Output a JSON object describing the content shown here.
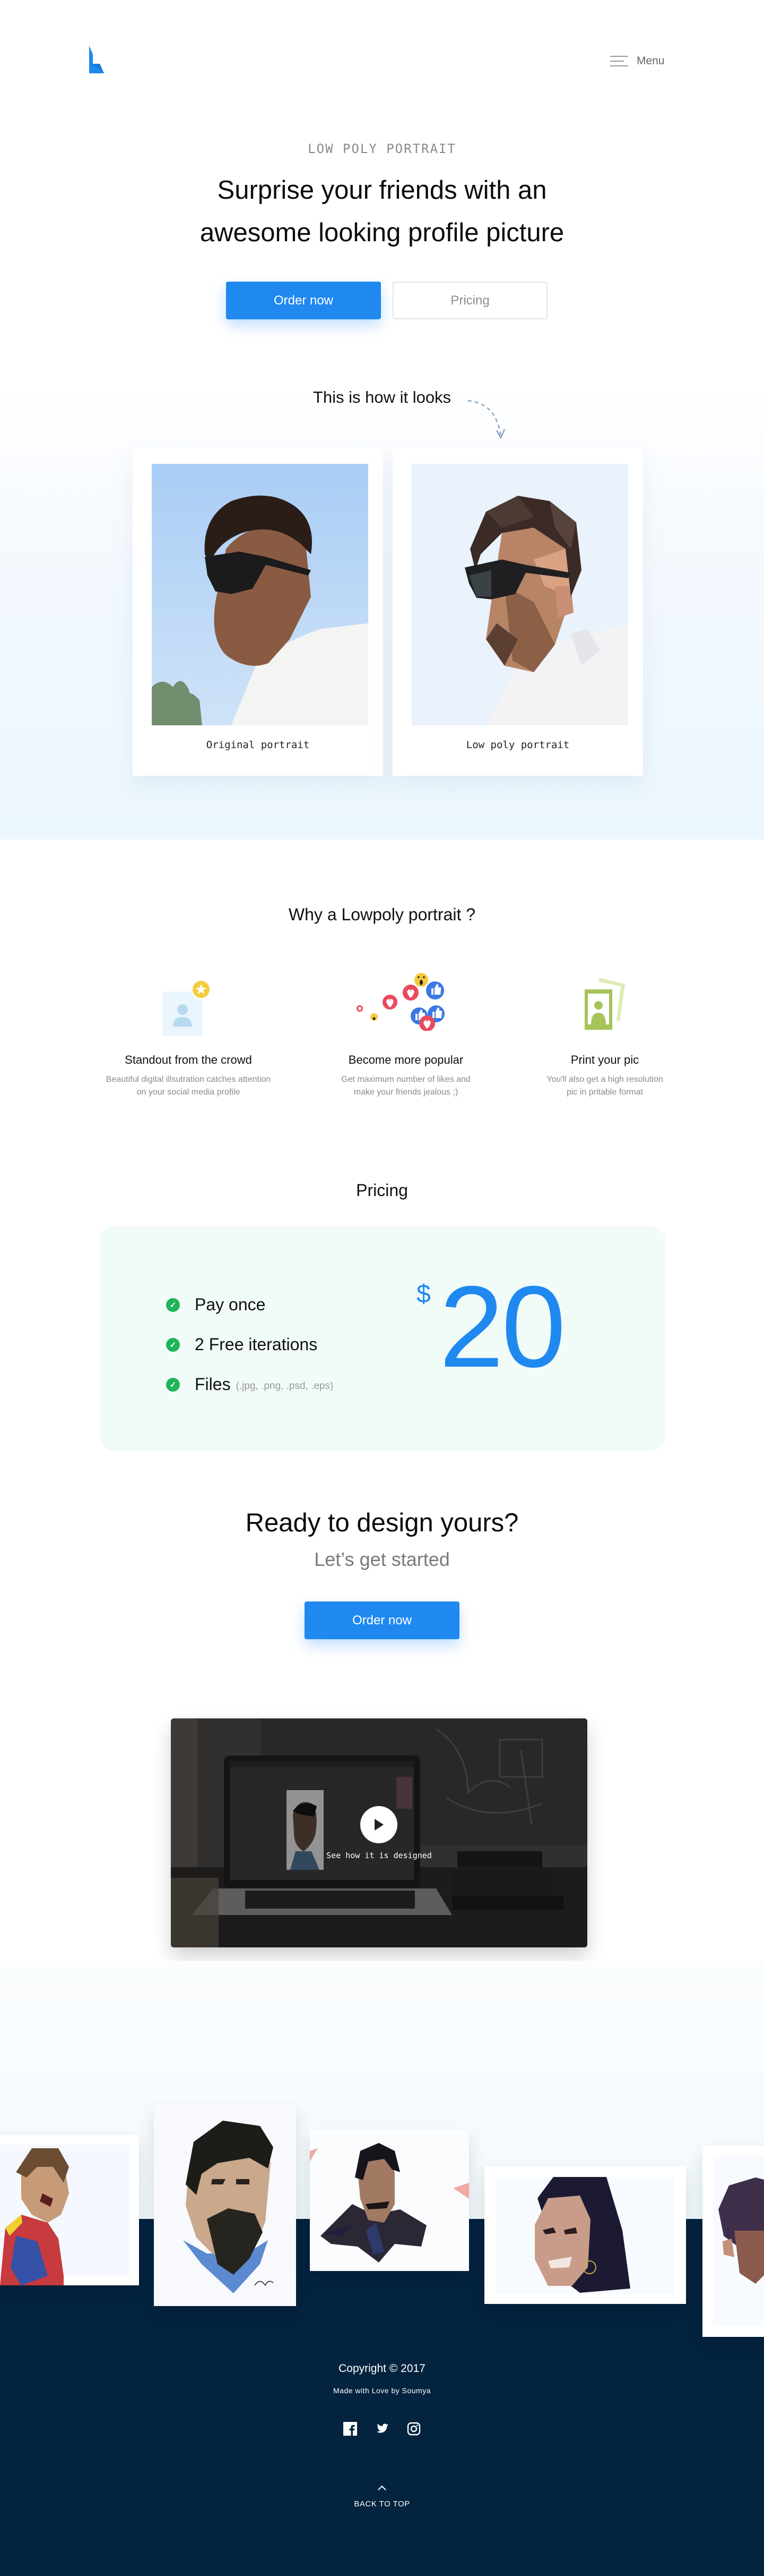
{
  "brand": {
    "accent": "#1f89f0",
    "footer_bg": "#04233f",
    "check_color": "#1fb45a"
  },
  "nav": {
    "logo_icon": "lowpoly-logo-icon",
    "menu_icon": "hamburger-icon",
    "menu_label": "Menu"
  },
  "hero": {
    "eyebrow": "LOW POLY PORTRAIT",
    "headline_line1": "Surprise your friends with an",
    "headline_line2": "awesome looking profile picture",
    "primary_button": "Order now",
    "secondary_button": "Pricing"
  },
  "comparison": {
    "title": "This is how it looks",
    "cards": [
      {
        "caption": "Original portrait",
        "image": "original-photo"
      },
      {
        "caption": "Low poly portrait",
        "image": "lowpoly-photo"
      }
    ]
  },
  "why": {
    "title": "Why a Lowpoly portrait ?",
    "features": [
      {
        "icon": "profile-star-icon",
        "title": "Standout from the crowd",
        "desc_line1": "Beautiful digital illsutration catches attention",
        "desc_line2": "on your social media profile"
      },
      {
        "icon": "reactions-icon",
        "title": "Become more popular",
        "desc_line1": "Get maximum number of likes and",
        "desc_line2": "make your friends jealous ;)"
      },
      {
        "icon": "print-photo-icon",
        "title": "Print your pic",
        "desc_line1": "You'll also get a high resolution",
        "desc_line2": "pic in pritable format"
      }
    ]
  },
  "pricing": {
    "title": "Pricing",
    "items": [
      {
        "label": "Pay once",
        "note": ""
      },
      {
        "label": "2 Free iterations",
        "note": ""
      },
      {
        "label": "Files",
        "note": "(.jpg, .png, .psd, .eps)"
      }
    ],
    "currency": "$",
    "amount": "20"
  },
  "cta": {
    "title": "Ready to design yours?",
    "subtitle": "Let’s get started",
    "button": "Order now"
  },
  "video": {
    "label": "See how it is designed",
    "icon": "play-icon"
  },
  "gallery": {
    "portraits": [
      "portrait-footballer",
      "portrait-cricketer",
      "portrait-actor",
      "portrait-woman",
      "portrait-man"
    ]
  },
  "footer": {
    "copyright": "Copyright © 2017",
    "made_with": "Made with Love by Soumya",
    "socials": [
      "facebook",
      "twitter",
      "instagram"
    ],
    "back_to_top": "BACK TO TOP"
  }
}
